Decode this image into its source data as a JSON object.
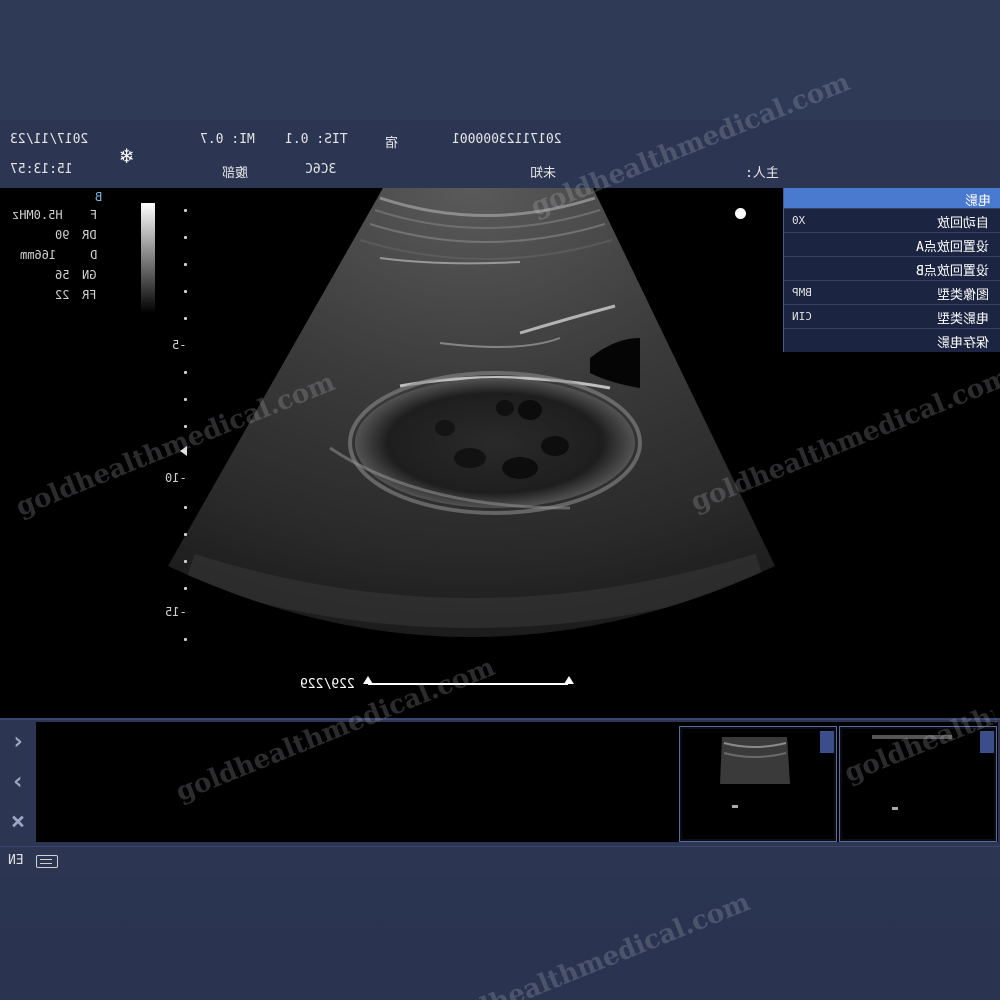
{
  "header": {
    "date": "2017/11/23",
    "time": "15:13:57",
    "mi": "MI: 0.7",
    "tis": "TIS: 0.1",
    "hospital": "宿",
    "patient_id": "20171123000001",
    "probe": "3C6C",
    "exam_region": "腹部",
    "patient_name": "未知",
    "doctor_label": "主人:",
    "freeze_icon": "snowflake-icon"
  },
  "params": {
    "mode": "B",
    "rows": [
      {
        "key": "F",
        "value": "H5.0MHz"
      },
      {
        "key": "DR",
        "value": "90"
      },
      {
        "key": "D",
        "value": "166mm"
      },
      {
        "key": "GN",
        "value": "56"
      },
      {
        "key": "FR",
        "value": "22"
      }
    ]
  },
  "depth_scale": {
    "labels": [
      "-5",
      "-10",
      "-15"
    ]
  },
  "cine_menu": {
    "title": "电影",
    "items": [
      {
        "label": "自动回放",
        "value": "X0"
      },
      {
        "label": "设置回放点A",
        "value": ""
      },
      {
        "label": "设置回放点B",
        "value": ""
      },
      {
        "label": "图像类型",
        "value": "BMP"
      },
      {
        "label": "电影类型",
        "value": "CIN"
      },
      {
        "label": "保存电影",
        "value": ""
      }
    ]
  },
  "cine": {
    "frame_count": "229/229"
  },
  "nav": {
    "next": "›",
    "prev": "‹",
    "close": "×"
  },
  "status": {
    "language": "EN",
    "keyboard_icon": "keyboard-icon"
  },
  "watermark": "goldhealthmedical.com"
}
